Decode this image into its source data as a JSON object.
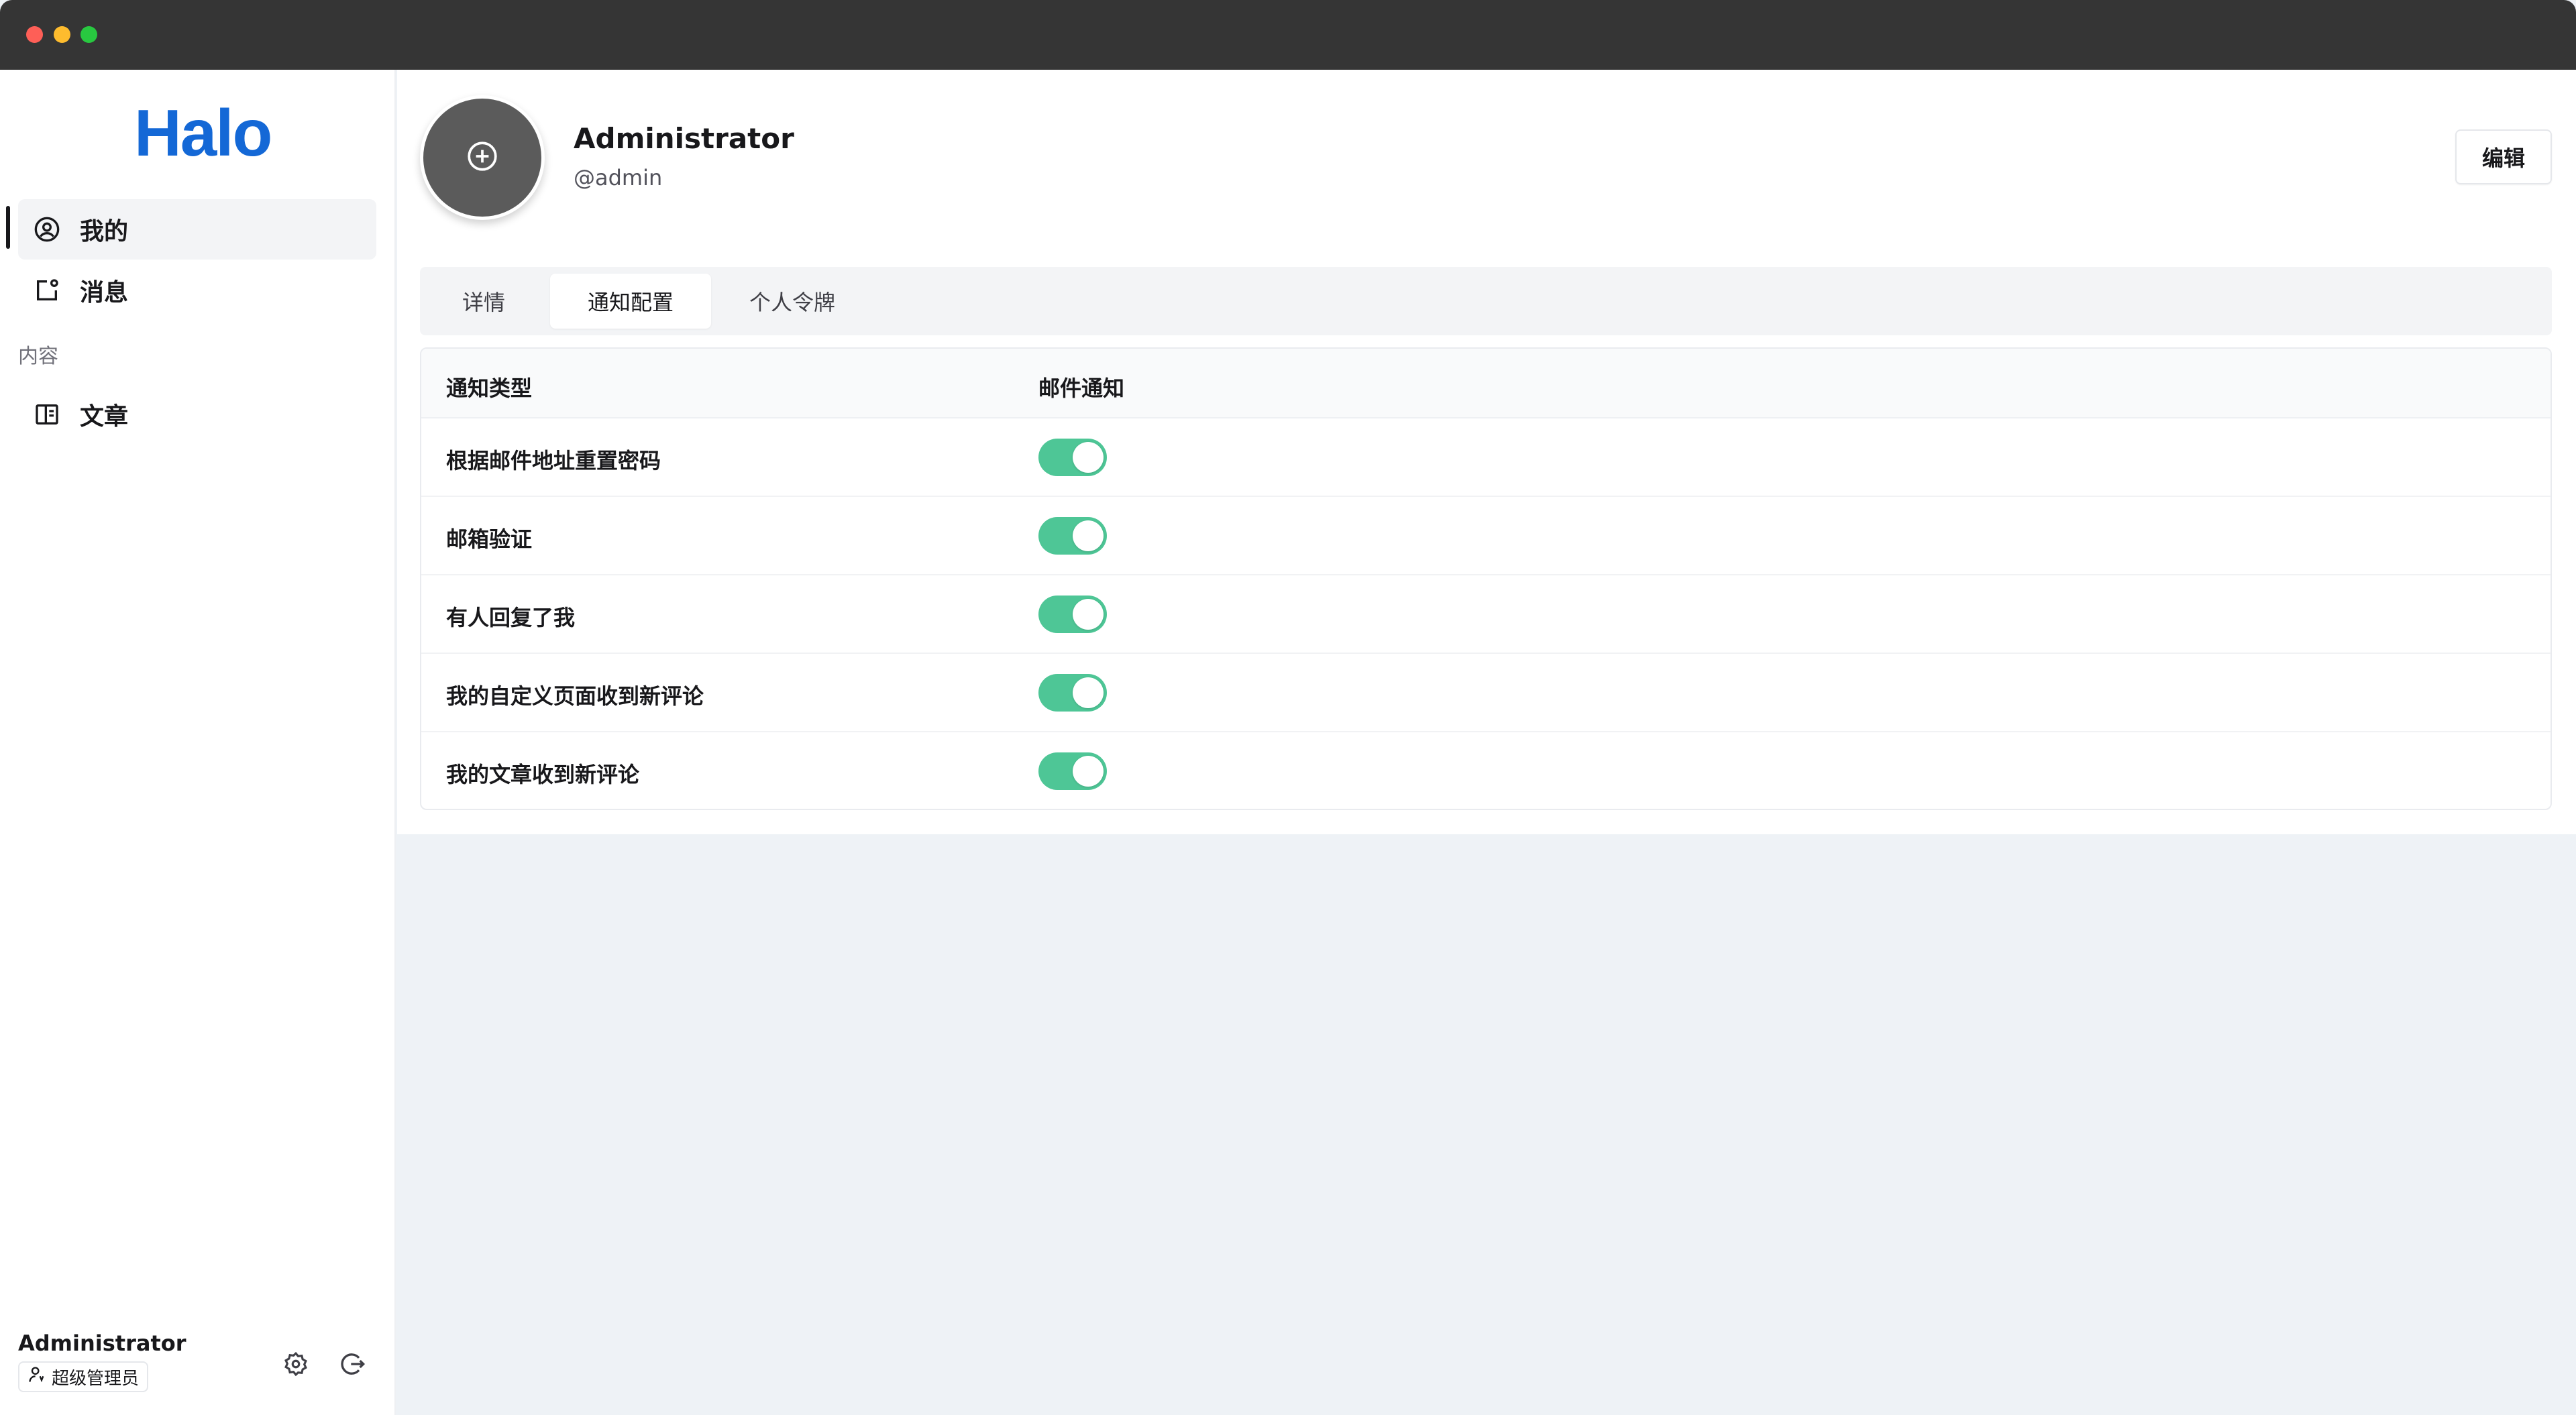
{
  "app": {
    "logo": "Halo"
  },
  "sidebar": {
    "items": [
      {
        "label": "我的",
        "icon": "user-circle-icon"
      },
      {
        "label": "消息",
        "icon": "notification-icon"
      }
    ],
    "group_label": "内容",
    "group_items": [
      {
        "label": "文章",
        "icon": "book-icon"
      }
    ],
    "user": {
      "name": "Administrator",
      "role": "超级管理员"
    },
    "footer_icons": [
      "settings-icon",
      "logout-icon"
    ]
  },
  "profile": {
    "name": "Administrator",
    "handle": "@admin",
    "edit_label": "编辑",
    "avatar_icon": "plus-circle-icon"
  },
  "tabs": [
    {
      "label": "详情",
      "active": false
    },
    {
      "label": "通知配置",
      "active": true
    },
    {
      "label": "个人令牌",
      "active": false
    }
  ],
  "table": {
    "headers": [
      "通知类型",
      "邮件通知"
    ],
    "rows": [
      {
        "label": "根据邮件地址重置密码",
        "email_enabled": true
      },
      {
        "label": "邮箱验证",
        "email_enabled": true
      },
      {
        "label": "有人回复了我",
        "email_enabled": true
      },
      {
        "label": "我的自定义页面收到新评论",
        "email_enabled": true
      },
      {
        "label": "我的文章收到新评论",
        "email_enabled": true
      }
    ]
  },
  "colors": {
    "accent": "#1468d6",
    "toggle_on": "#4ec696",
    "titlebar": "#353535"
  }
}
